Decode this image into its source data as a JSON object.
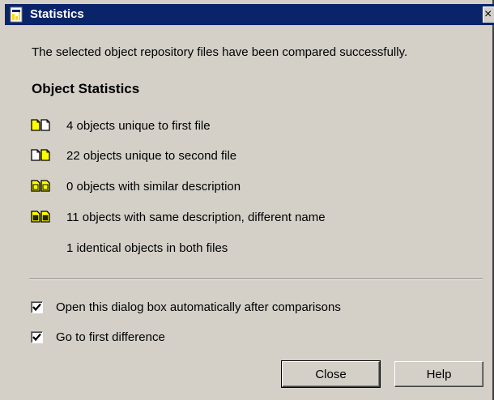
{
  "window": {
    "title": "Statistics",
    "close_glyph": "×"
  },
  "intro_text": "The selected object repository files have been compared successfully.",
  "stats_heading": "Object Statistics",
  "stats": [
    {
      "icon": "unique-first-file-icon",
      "text": "4 objects unique to first file"
    },
    {
      "icon": "unique-second-file-icon",
      "text": "22 objects unique to second file"
    },
    {
      "icon": "similar-description-icon",
      "text": "0 objects with similar description"
    },
    {
      "icon": "same-description-icon",
      "text": "11 objects with same description, different name"
    },
    {
      "icon": "",
      "text": "1 identical objects in both files"
    }
  ],
  "options": [
    {
      "label": "Open this dialog box automatically after comparisons",
      "checked": true
    },
    {
      "label": "Go to first difference",
      "checked": true
    }
  ],
  "buttons": {
    "close_label": "Close",
    "help_label": "Help"
  },
  "colors": {
    "titlebar": "#0a246a",
    "dialog_bg": "#d4d0c8",
    "doc_icon_yellow": "#ffff00"
  }
}
